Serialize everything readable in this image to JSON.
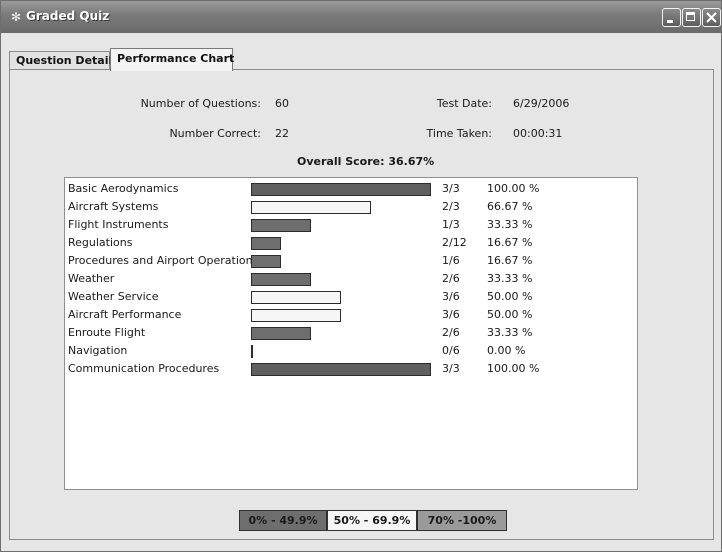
{
  "window": {
    "title": "Graded Quiz",
    "app_icon": "✻"
  },
  "tabs": [
    {
      "label": "Question Detail",
      "active": false
    },
    {
      "label": "Performance Chart",
      "active": true
    }
  ],
  "stats": {
    "num_questions_label": "Number of Questions:",
    "num_questions_value": "60",
    "num_correct_label": "Number Correct:",
    "num_correct_value": "22",
    "test_date_label": "Test Date:",
    "test_date_value": "6/29/2006",
    "time_taken_label": "Time Taken:",
    "time_taken_value": "00:00:31",
    "overall_label": "Overall Score:",
    "overall_value": "36.67%"
  },
  "categories": [
    {
      "name": "Basic Aerodynamics",
      "fraction": "3/3",
      "percent_text": "100.00 %",
      "percent": 100
    },
    {
      "name": "Aircraft Systems",
      "fraction": "2/3",
      "percent_text": "66.67 %",
      "percent": 66.67
    },
    {
      "name": "Flight Instruments",
      "fraction": "1/3",
      "percent_text": "33.33 %",
      "percent": 33.33
    },
    {
      "name": "Regulations",
      "fraction": "2/12",
      "percent_text": "16.67 %",
      "percent": 16.67
    },
    {
      "name": "Procedures and Airport Operations",
      "fraction": "1/6",
      "percent_text": "16.67 %",
      "percent": 16.67
    },
    {
      "name": "Weather",
      "fraction": "2/6",
      "percent_text": "33.33 %",
      "percent": 33.33
    },
    {
      "name": "Weather Service",
      "fraction": "3/6",
      "percent_text": "50.00 %",
      "percent": 50
    },
    {
      "name": "Aircraft Performance",
      "fraction": "3/6",
      "percent_text": "50.00 %",
      "percent": 50
    },
    {
      "name": "Enroute Flight",
      "fraction": "2/6",
      "percent_text": "33.33 %",
      "percent": 33.33
    },
    {
      "name": "Navigation",
      "fraction": "0/6",
      "percent_text": "0.00 %",
      "percent": 0
    },
    {
      "name": "Communication Procedures",
      "fraction": "3/3",
      "percent_text": "100.00 %",
      "percent": 100
    }
  ],
  "legend": [
    {
      "label": "0% - 49.9%",
      "color": "#6e6e6e"
    },
    {
      "label": "50% - 69.9%",
      "color": "#f6f6f6"
    },
    {
      "label": "70% -100%",
      "color": "#9a9a9a"
    }
  ],
  "colors": {
    "low": "#6e6e6e",
    "mid": "#f6f6f6",
    "high": "#5f5f5f"
  }
}
